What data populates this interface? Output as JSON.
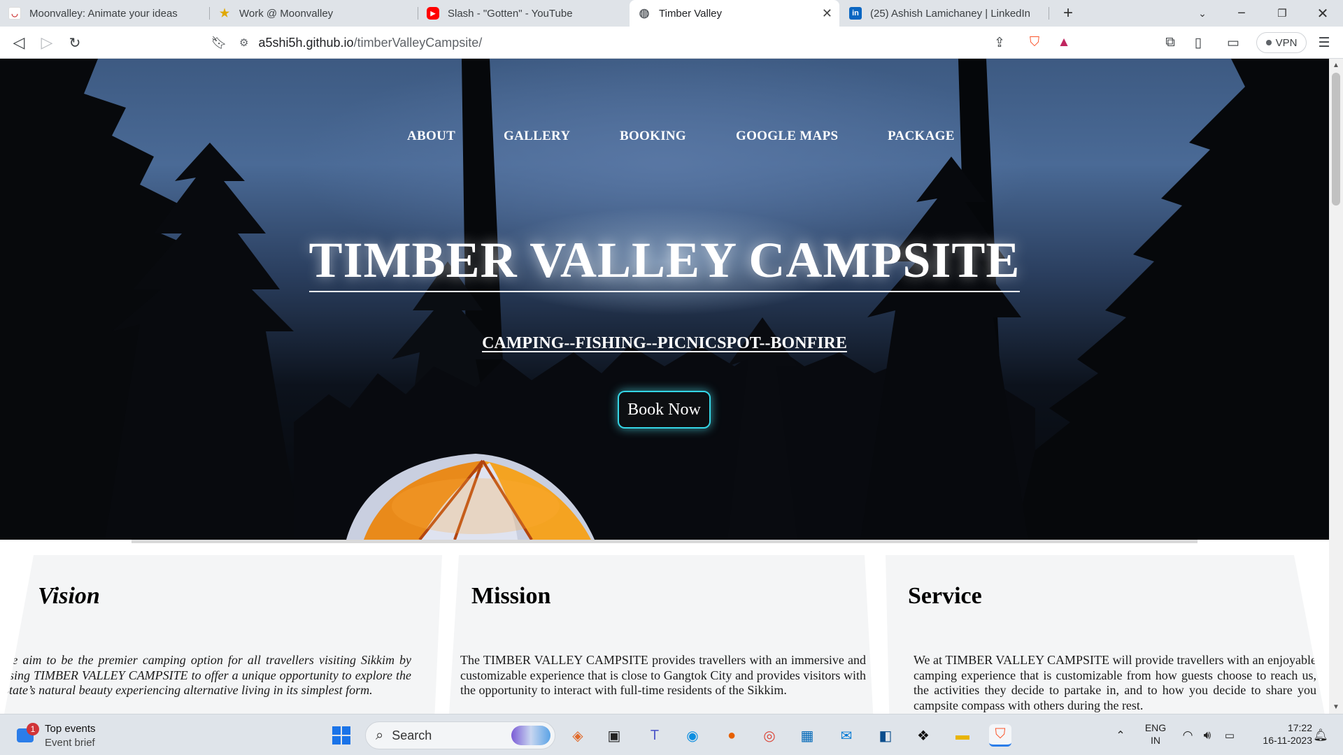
{
  "browser": {
    "tabs": [
      {
        "title": "Moonvalley: Animate your ideas",
        "icon": "moonvalley-icon"
      },
      {
        "title": "Work @ Moonvalley",
        "icon": "star-icon"
      },
      {
        "title": "Slash - \"Gotten\" - YouTube",
        "icon": "youtube-icon"
      },
      {
        "title": "Timber Valley",
        "icon": "globe-icon"
      },
      {
        "title": "(25) Ashish Lamichaney | LinkedIn",
        "icon": "linkedin-icon"
      }
    ],
    "url_host": "a5shi5h.github.io",
    "url_path": "/timberValleyCampsite/",
    "vpn_label": "VPN"
  },
  "hero": {
    "nav": [
      "ABOUT",
      "GALLERY",
      "BOOKING",
      "GOOGLE MAPS",
      "PACKAGE"
    ],
    "title": "TIMBER VALLEY CAMPSITE",
    "subtitle": "CAMPING--FISHING--PICNICSPOT--BONFIRE",
    "cta": "Book Now"
  },
  "cards": [
    {
      "heading": "Vision",
      "text": "We aim to be the premier camping option for all travellers visiting Sikkim by using TIMBER VALLEY CAMPSITE to offer a unique opportunity to explore the State’s natural beauty experiencing alternative living in its simplest form."
    },
    {
      "heading": "Mission",
      "text": "The TIMBER VALLEY CAMPSITE provides travellers with an immersive and customizable experience that is close to Gangtok City and provides visitors with the opportunity to interact with full-time residents of the Sikkim."
    },
    {
      "heading": "Service",
      "text": "We at TIMBER VALLEY CAMPSITE will provide travellers with an enjoyable camping experience that is customizable from how guests choose to reach us, the activities they decide to partake in, and to how you decide to share you campsite compass with others during the rest."
    }
  ],
  "taskbar": {
    "widget_title": "Top events",
    "widget_sub": "Event brief",
    "widget_badge": "1",
    "search_placeholder": "Search",
    "lang_top": "ENG",
    "lang_bottom": "IN",
    "time": "17:22",
    "date": "16-11-2023"
  }
}
